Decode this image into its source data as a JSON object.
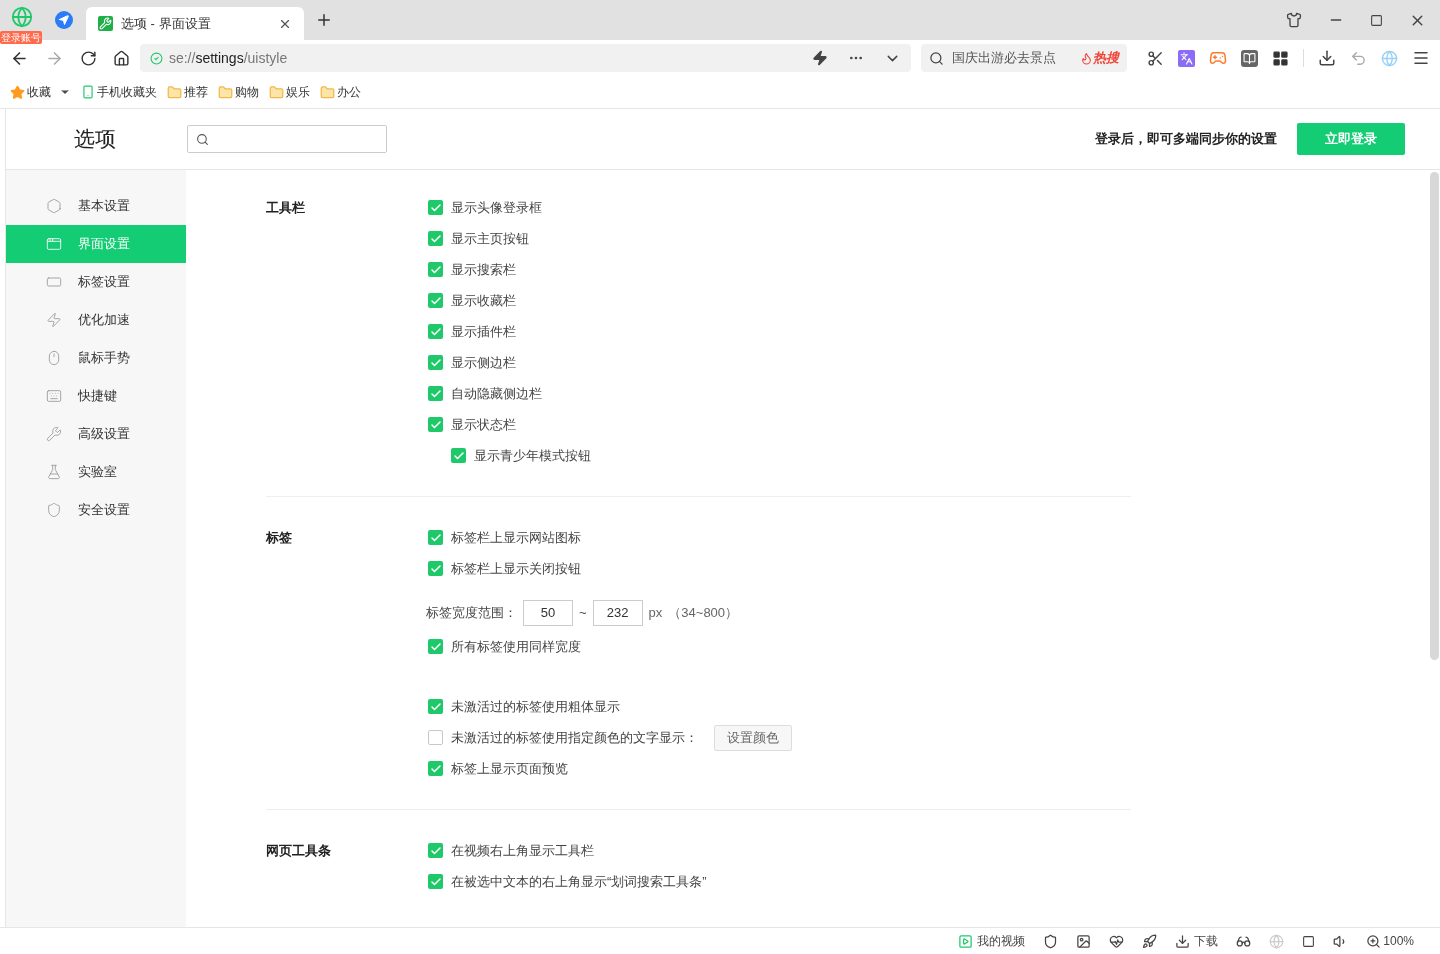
{
  "browser": {
    "account_badge": "登录账号",
    "tabs": [
      {
        "title": "选项 - 界面设置",
        "selected": true
      }
    ],
    "address": "se://**settings**/uistyle",
    "search": {
      "text": "国庆出游必去景点",
      "hot": "热搜"
    }
  },
  "bookmarks": [
    {
      "kind": "star",
      "label": "收藏"
    },
    {
      "kind": "phone",
      "label": "手机收藏夹"
    },
    {
      "kind": "folder",
      "label": "推荐"
    },
    {
      "kind": "folder",
      "label": "购物"
    },
    {
      "kind": "folder",
      "label": "娱乐"
    },
    {
      "kind": "folder",
      "label": "办公"
    }
  ],
  "header": {
    "title": "选项",
    "sync_text": "登录后，即可多端同步你的设置",
    "login_button": "立即登录"
  },
  "sidebar": {
    "items": [
      {
        "label": "基本设置",
        "selected": false
      },
      {
        "label": "界面设置",
        "selected": true
      },
      {
        "label": "标签设置",
        "selected": false
      },
      {
        "label": "优化加速",
        "selected": false
      },
      {
        "label": "鼠标手势",
        "selected": false
      },
      {
        "label": "快捷键",
        "selected": false
      },
      {
        "label": "高级设置",
        "selected": false
      },
      {
        "label": "实验室",
        "selected": false
      },
      {
        "label": "安全设置",
        "selected": false
      }
    ]
  },
  "sections": [
    {
      "title": "工具栏",
      "groups": [
        [
          {
            "kind": "checkbox",
            "label": "显示头像登录框",
            "checked": true
          },
          {
            "kind": "checkbox",
            "label": "显示主页按钮",
            "checked": true
          },
          {
            "kind": "checkbox",
            "label": "显示搜索栏",
            "checked": true
          },
          {
            "kind": "checkbox",
            "label": "显示收藏栏",
            "checked": true
          },
          {
            "kind": "checkbox",
            "label": "显示插件栏",
            "checked": true
          },
          {
            "kind": "checkbox",
            "label": "显示侧边栏",
            "checked": true
          },
          {
            "kind": "checkbox",
            "label": "自动隐藏侧边栏",
            "checked": true
          },
          {
            "kind": "checkbox",
            "label": "显示状态栏",
            "checked": true,
            "children": [
              {
                "kind": "checkbox",
                "label": "显示青少年模式按钮",
                "checked": true
              }
            ]
          }
        ]
      ]
    },
    {
      "title": "标签",
      "groups": [
        [
          {
            "kind": "checkbox",
            "label": "标签栏上显示网站图标",
            "checked": true
          },
          {
            "kind": "checkbox",
            "label": "标签栏上显示关闭按钮",
            "checked": true
          },
          {
            "kind": "range",
            "label": "标签宽度范围：",
            "min": "50",
            "separator": "~",
            "max": "232",
            "unit": "px",
            "hint": "（34~800）"
          },
          {
            "kind": "checkbox",
            "label": "所有标签使用同样宽度",
            "checked": true
          }
        ],
        [
          {
            "kind": "checkbox",
            "label": "未激活过的标签使用粗体显示",
            "checked": true
          },
          {
            "kind": "checkbox",
            "label": "未激活过的标签使用指定颜色的文字显示：",
            "checked": false,
            "button": "设置颜色"
          },
          {
            "kind": "checkbox",
            "label": "标签上显示页面预览",
            "checked": true
          }
        ]
      ]
    },
    {
      "title": "网页工具条",
      "groups": [
        [
          {
            "kind": "checkbox",
            "label": "在视频右上角显示工具栏",
            "checked": true
          },
          {
            "kind": "checkbox",
            "label": "在被选中文本的右上角显示“划词搜索工具条”",
            "checked": true
          }
        ]
      ]
    }
  ],
  "status_bar": {
    "video": "我的视频",
    "download": "下载",
    "zoom": "100%"
  }
}
